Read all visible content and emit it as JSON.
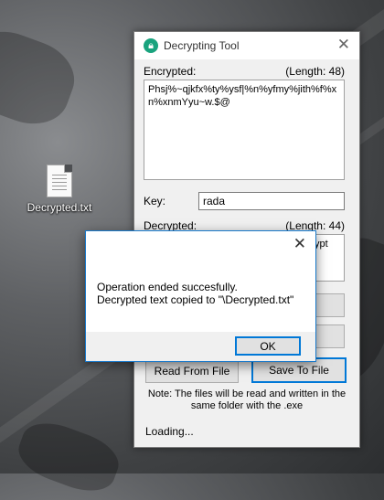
{
  "desktop": {
    "icon_label": "Decrypted.txt"
  },
  "window": {
    "title": "Decrypting Tool",
    "encrypted_label": "Encrypted:",
    "encrypted_length": "(Length: 48)",
    "encrypted_text": "Phsj%~qjkfx%ty%ysf|%n%yfmy%jith%f%xn%xnmYyu~w.$@",
    "key_label": "Key:",
    "key_value": "rada",
    "decrypted_label": "Decrypted:",
    "decrypted_length": "(Length: 44)",
    "decrypted_text_visible": "ypt",
    "read_button": "Read From File",
    "save_button": "Save To File",
    "note": "Note: The files will be read and written in the same folder with the .exe",
    "status": "Loading..."
  },
  "dialog": {
    "message_line1": "Operation ended succesfully.",
    "message_line2": "Decrypted text copied to \"\\Decrypted.txt\"",
    "ok_button": "OK"
  }
}
